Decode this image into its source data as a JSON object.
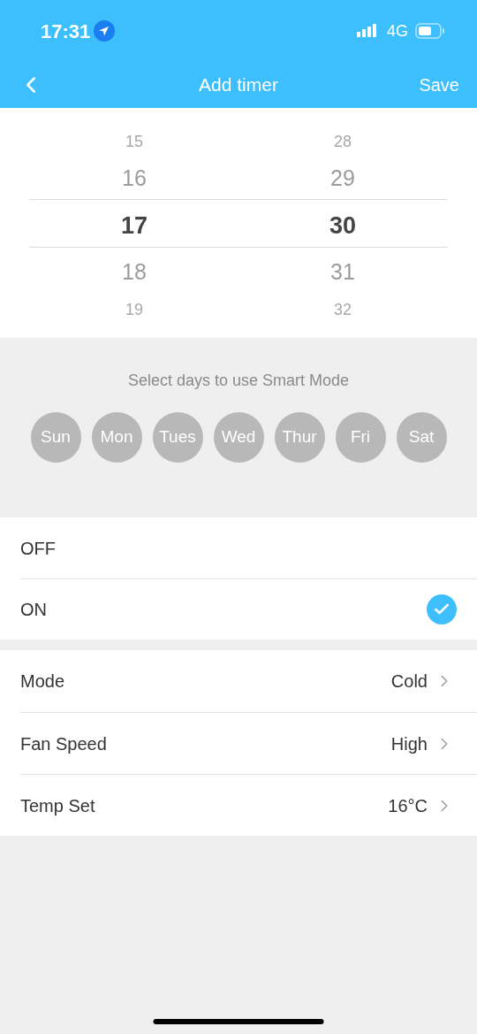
{
  "status_bar": {
    "time": "17:31",
    "network": "4G"
  },
  "nav": {
    "title": "Add timer",
    "save": "Save"
  },
  "picker": {
    "columns": [
      {
        "above": [
          "15",
          "16"
        ],
        "current": "17",
        "below": [
          "18",
          "19"
        ]
      },
      {
        "above": [
          "28",
          "29"
        ],
        "current": "30",
        "below": [
          "31",
          "32"
        ]
      }
    ]
  },
  "days": {
    "prompt": "Select days to use Smart Mode",
    "items": [
      {
        "label": "Sun",
        "selected": false
      },
      {
        "label": "Mon",
        "selected": false
      },
      {
        "label": "Tues",
        "selected": false
      },
      {
        "label": "Wed",
        "selected": false
      },
      {
        "label": "Thur",
        "selected": false
      },
      {
        "label": "Fri",
        "selected": false
      },
      {
        "label": "Sat",
        "selected": false
      }
    ]
  },
  "power_options": [
    {
      "label": "OFF",
      "selected": false
    },
    {
      "label": "ON",
      "selected": true
    }
  ],
  "settings": [
    {
      "label": "Mode",
      "value": "Cold"
    },
    {
      "label": "Fan Speed",
      "value": "High"
    },
    {
      "label": "Temp Set",
      "value": "16°C"
    }
  ]
}
